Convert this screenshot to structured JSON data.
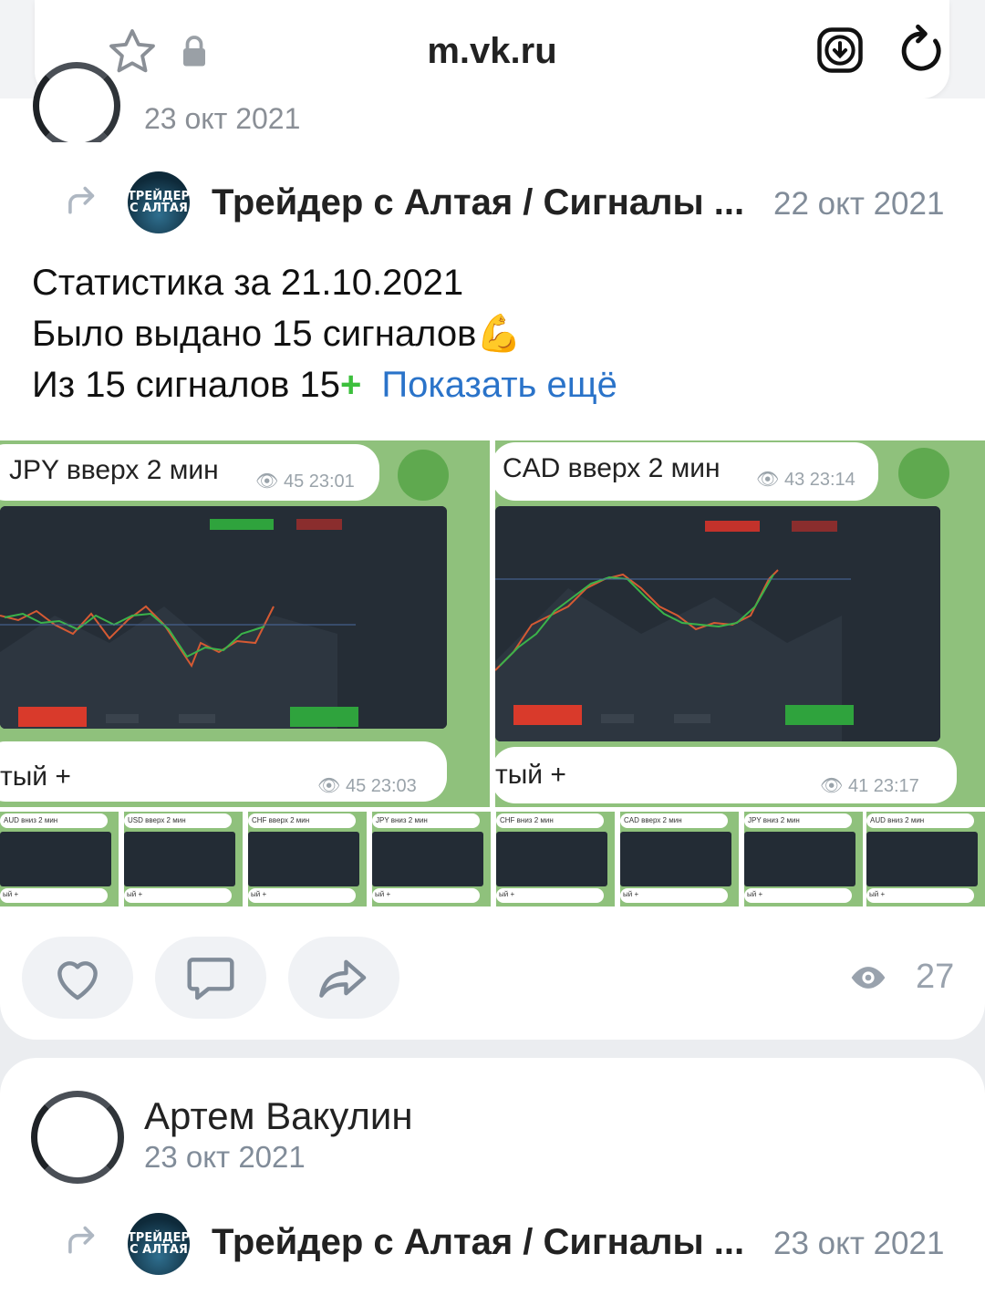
{
  "browser": {
    "url": "m.vk.ru",
    "icons": [
      "star-icon",
      "lock-icon",
      "download-icon",
      "reload-icon"
    ]
  },
  "prev_post": {
    "date": "23 окт 2021"
  },
  "post": {
    "repost_source": "Трейдер с Алтая / Сигналы ...",
    "repost_date": "22 окт 2021",
    "avatar_text_line1": "ТРЕЙДЕР",
    "avatar_text_line2": "С АЛТАЯ",
    "text_line1": "Статистика за 21.10.2021",
    "text_line2": "Было выдано 15 сигналов",
    "text_line2_emoji": "💪",
    "text_line3": "Из 15 сигналов 15",
    "text_line3_plus": "+",
    "show_more": "Показать ещё",
    "gallery_large": [
      {
        "message": "JPY вверх 2 мин",
        "meta_top": "45 23:01",
        "caption": "тый +",
        "meta_bottom": "45 23:03"
      },
      {
        "message": "CAD вверх 2 мин",
        "meta_top": "43 23:14",
        "caption": "тый +",
        "meta_bottom": "41 23:17"
      }
    ],
    "gallery_thumbs": [
      {
        "title": "AUD вниз 2 мин",
        "foot": "ый +"
      },
      {
        "title": "USD вверх 2 мин",
        "foot": "ый +"
      },
      {
        "title": "CHF вверх 2 мин",
        "foot": "ый +"
      },
      {
        "title": "JPY вниз 2 мин",
        "foot": "ый +"
      },
      {
        "title": "CHF вниз 2 мин",
        "foot": "ый +"
      },
      {
        "title": "CAD вверх 2 мин",
        "foot": "ый +"
      },
      {
        "title": "JPY вниз 2 мин",
        "foot": "ый +"
      },
      {
        "title": "AUD вниз 2 мин",
        "foot": "ый +"
      }
    ],
    "actions": {
      "like_icon": "heart-icon",
      "comment_icon": "comment-icon",
      "share_icon": "share-icon"
    },
    "views": "27"
  },
  "next_post": {
    "author": "Артем Вакулин",
    "date": "23 окт 2021",
    "repost_source": "Трейдер с Алтая / Сигналы ...",
    "repost_date": "23 окт 2021"
  },
  "colors": {
    "link": "#2a73c9",
    "plus": "#3cbf3c",
    "chat_bg": "#8fc17c",
    "muted": "#818c99"
  }
}
